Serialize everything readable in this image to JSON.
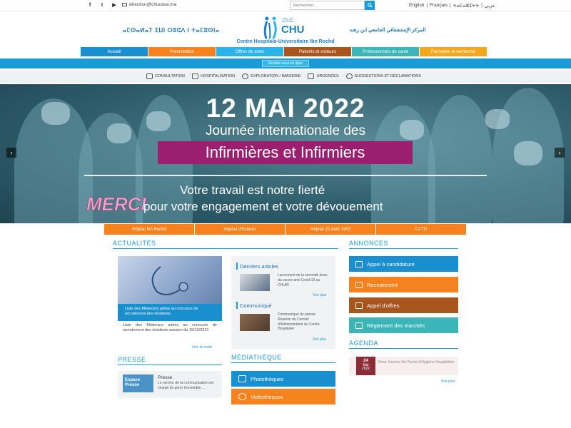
{
  "topbar": {
    "social": [
      "f",
      "t",
      "▶"
    ],
    "email": "direction@chucasa.ma",
    "search_placeholder": "Rechercher...",
    "languages": [
      "English",
      "Français",
      "ⵜⴰⵎⴰⵣⵉⵖⵜ",
      "عربي"
    ]
  },
  "header": {
    "tifinagh": "ⴰⵎⵙⴰⵍⴰⵢ ⵉⵡⵏ ⵔⵓⵛⴷ ⵏ ⵜⴰⵎⵓⵙⵏⴰ",
    "arabic": "المركز الإستشفائي الجامعي ابن رشد",
    "logo_text": "CHU",
    "logo_small_ar": "ابن رشد",
    "logo_small_fr": "Ibn Rochd",
    "centre_name": "Centre Hospitalo-Universitaire Ibn Rochd"
  },
  "mainnav": [
    {
      "label": "Accueil",
      "color": "#1a8fcf"
    },
    {
      "label": "Présentation",
      "color": "#f5821f"
    },
    {
      "label": "Offres de soins",
      "color": "#2bb3e8"
    },
    {
      "label": "Patients et visiteurs",
      "color": "#a9551e"
    },
    {
      "label": "Professionnels de santé",
      "color": "#3bb5b7"
    },
    {
      "label": "Formation et recherche",
      "color": "#f0a81e"
    }
  ],
  "rdv": "Rendez-vous en ligne",
  "subnav": [
    "CONSULTATION",
    "HOSPITALISATION",
    "EXPLORATION / IMAGERIE",
    "URGENCES",
    "SUGGESTIONS ET RÉCLAMATIONS"
  ],
  "hero": {
    "date": "12 MAI 2022",
    "line1": "Journée internationale des",
    "band": "Infirmières et Infirmiers",
    "line3": "Votre travail est notre fierté",
    "merci": "MERCI",
    "line4": "pour votre engagement et votre dévouement"
  },
  "hospitals": [
    "Hôpital Ibn Rochd",
    "Hôpital d'Enfants",
    "Hôpital 20 Août 1953",
    "CCTD"
  ],
  "actualites": {
    "title": "ACTUALITÉS",
    "caption": "Liste des Médecins admis au concours de recrutement des résidents.",
    "text": "Liste des Médecins admis au concours de recrutement des résidents session du 15/12/2021",
    "more": "Lire la suite"
  },
  "sidebox": {
    "articles_title": "Derniers articles",
    "articles_text": "Lancement de la seconde dose du vaccin anti-Covid-19 au CHUIR",
    "communique_title": "Communiqué",
    "communique_text": "Communiqué de presse Réunion du Conseil d'Administration du Centre Hospitalier",
    "voir_plus": "Voir plus"
  },
  "annonces": {
    "title": "ANNONCES",
    "buttons": [
      {
        "label": "Appel à candidature",
        "color": "#1a8fcf"
      },
      {
        "label": "Recrutement",
        "color": "#f5821f"
      },
      {
        "label": "Appel d'offres",
        "color": "#a9551e"
      },
      {
        "label": "Règlement des marchés",
        "color": "#3bb5b7"
      }
    ]
  },
  "agenda": {
    "title": "AGENDA",
    "day": "24",
    "month": "Mai",
    "year": "2022",
    "text": "2ème Journée Ibn Rochd d'Hygiène Hospitalière",
    "more": "Voir plus"
  },
  "presse": {
    "title": "PRESSE",
    "img_text": "Espace Presse",
    "card_title": "Presse",
    "card_text": "Le service de la communication est chargé de gérer l'ensemble ..."
  },
  "mediatheque": {
    "title": "MÉDIATHÈQUE",
    "buttons": [
      {
        "label": "Photothèques",
        "color": "#1a8fcf"
      },
      {
        "label": "Vidéothèques",
        "color": "#f5821f"
      }
    ]
  }
}
